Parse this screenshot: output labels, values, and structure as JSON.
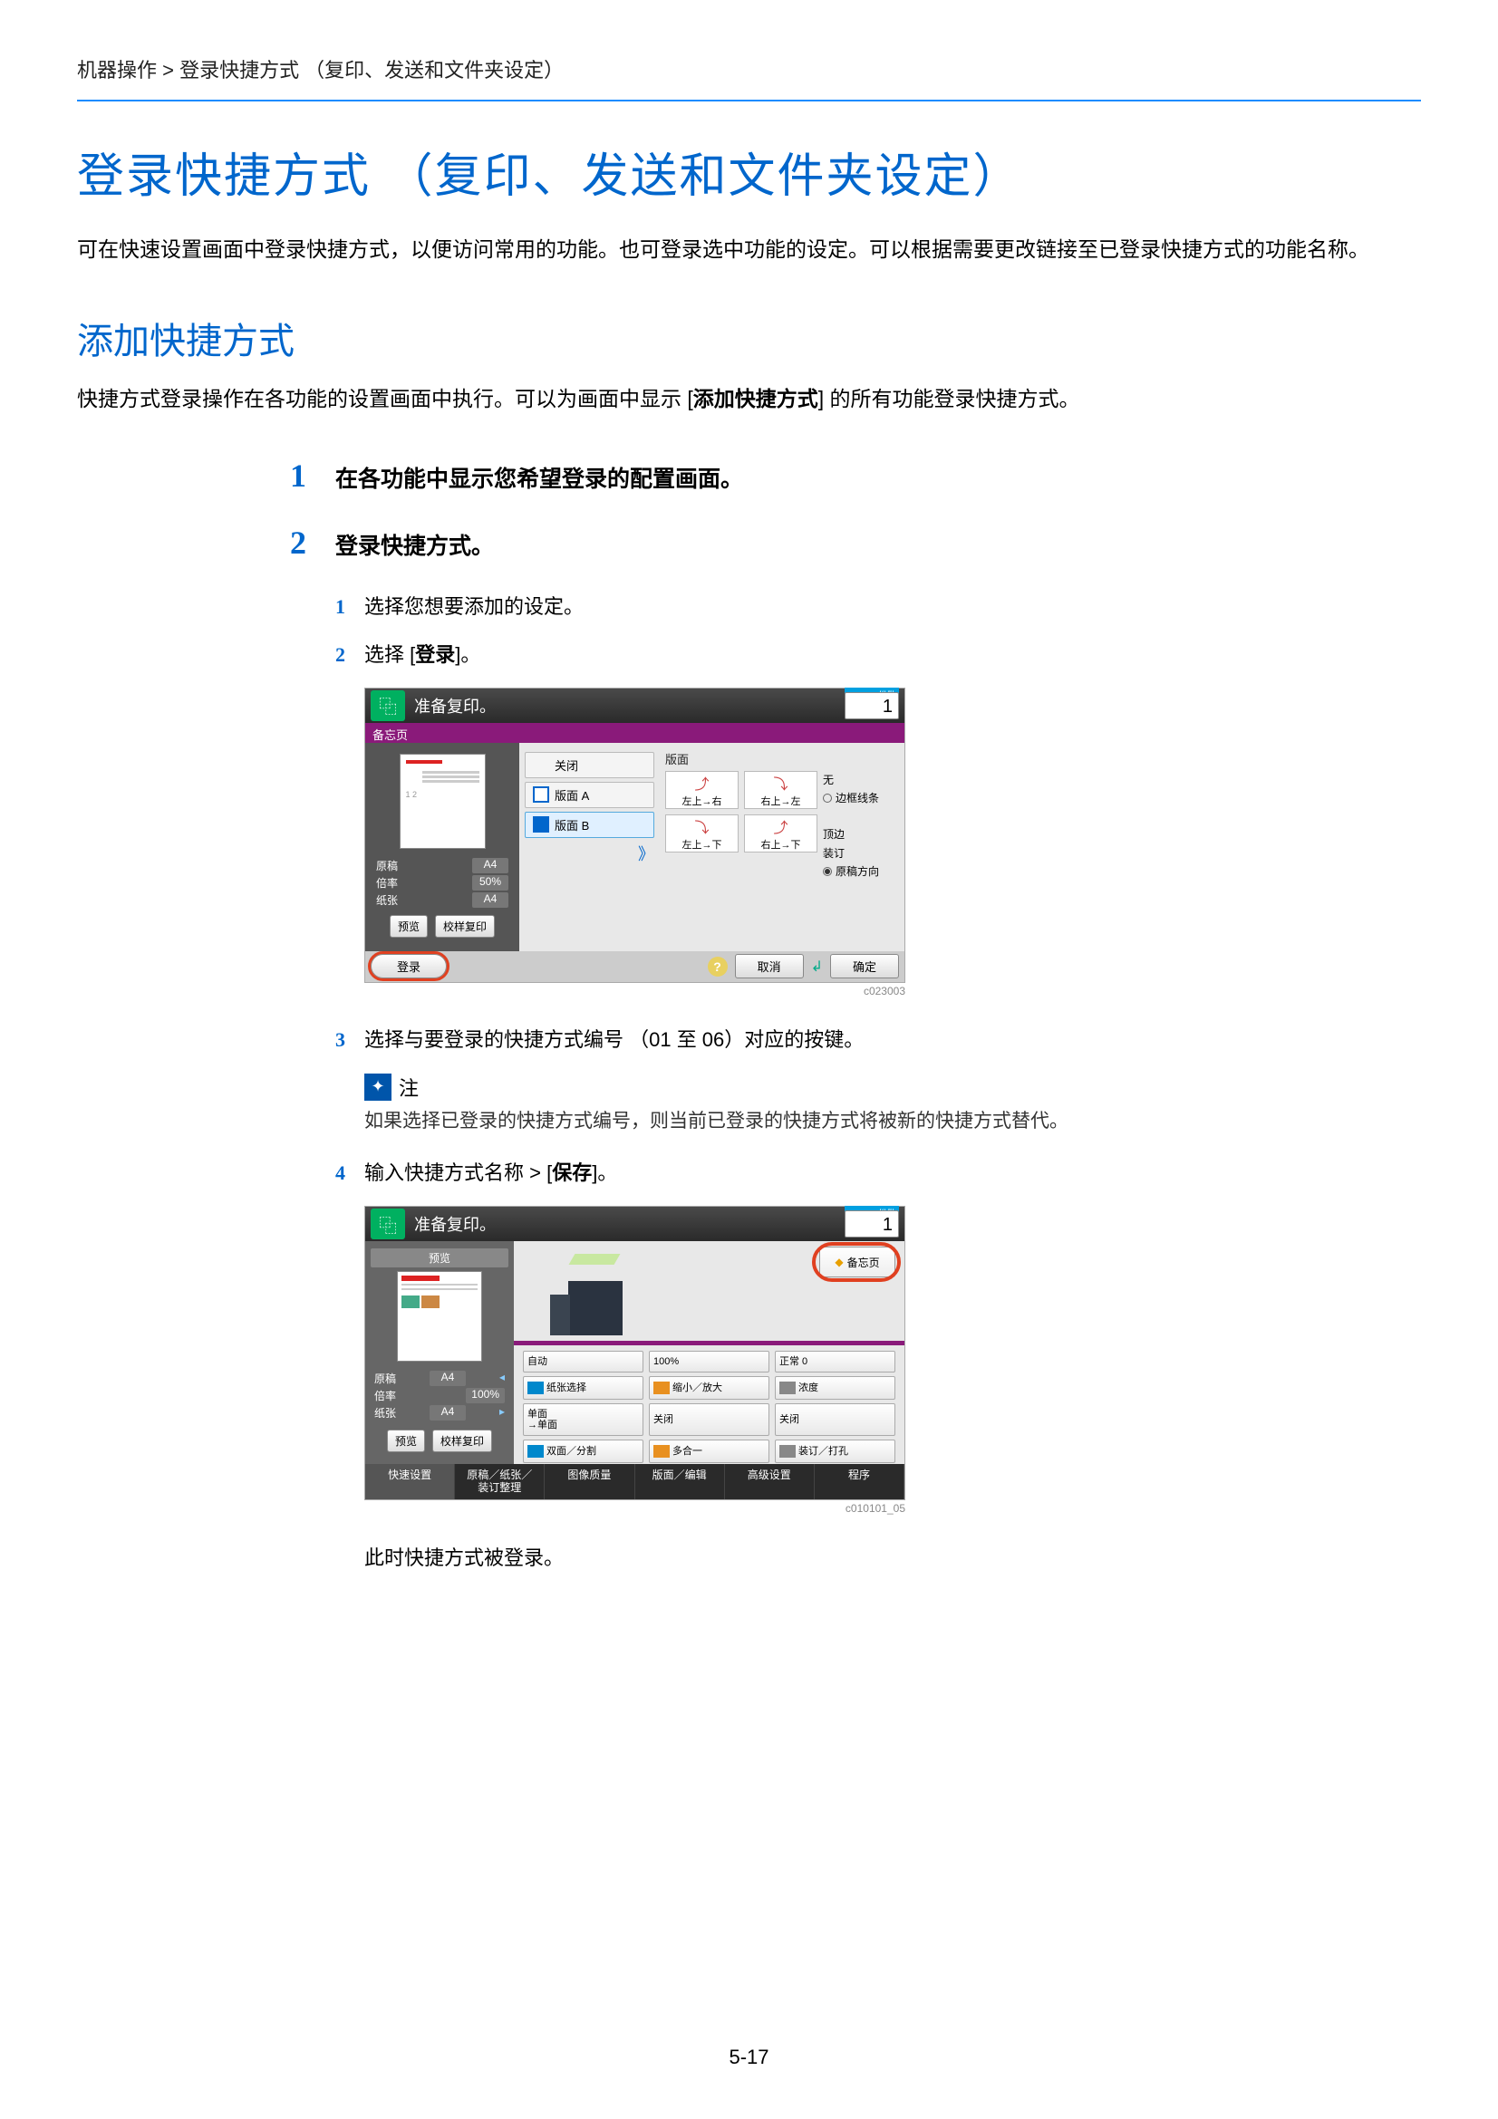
{
  "breadcrumb": "机器操作 > 登录快捷方式 （复印、发送和文件夹设定）",
  "h1": "登录快捷方式 （复印、发送和文件夹设定）",
  "intro": "可在快速设置画面中登录快捷方式，以便访问常用的功能。也可登录选中功能的设定。可以根据需要更改链接至已登录快捷方式的功能名称。",
  "h2": "添加快捷方式",
  "sub_intro_a": "快捷方式登录操作在各功能的设置画面中执行。可以为画面中显示 [",
  "sub_intro_bold": "添加快捷方式",
  "sub_intro_b": "] 的所有功能登录快捷方式。",
  "steps": {
    "s1": {
      "num": "1",
      "title": "在各功能中显示您希望登录的配置画面。"
    },
    "s2": {
      "num": "2",
      "title": "登录快捷方式。"
    }
  },
  "subs": {
    "i1": {
      "num": "1",
      "text": "选择您想要添加的设定。"
    },
    "i2": {
      "num": "2",
      "text_a": "选择 [",
      "bold": "登录",
      "text_b": "]。"
    },
    "i3": {
      "num": "3",
      "text": "选择与要登录的快捷方式编号 （01 至 06）对应的按键。"
    },
    "i4": {
      "num": "4",
      "text_a": "输入快捷方式名称 > [",
      "bold": "保存",
      "text_b": "]。"
    }
  },
  "panel1": {
    "header": "准备复印。",
    "copies_label": "份数",
    "copies": "1",
    "favbar": "备忘页",
    "left": {
      "r1a": "原稿",
      "r1b": "A4",
      "r2a": "倍率",
      "r2b": "50%",
      "r3a": "纸张",
      "r3b": "A4",
      "btn1": "预览",
      "btn2": "校样复印"
    },
    "mid": {
      "opt_off": "关闭",
      "opt_a": "版面 A",
      "opt_b": "版面 B"
    },
    "right": {
      "sec": "版面",
      "c1": "左上→右",
      "c2": "右上→左",
      "c3": "左上→下",
      "c4": "右上→下",
      "none": "无",
      "border_label": "边框线条",
      "pos_top": "顶边",
      "pos_long": "装订",
      "dir_label": "原稿方向"
    },
    "footer": {
      "register": "登录",
      "cancel": "取消",
      "ok": "确定"
    },
    "code": "c023003"
  },
  "note": {
    "title": "注",
    "body": "如果选择已登录的快捷方式编号，则当前已登录的快捷方式将被新的快捷方式替代。"
  },
  "panel2": {
    "header": "准备复印。",
    "copies_label": "份数",
    "copies": "1",
    "preview_label": "预览",
    "left": {
      "r1a": "原稿",
      "r1b": "A4",
      "r2a": "倍率",
      "r2b": "100%",
      "r3a": "纸张",
      "r3b": "A4",
      "btn1": "预览",
      "btn2": "校样复印"
    },
    "fav_btn": "备忘页",
    "grid": {
      "b11a": "自动",
      "b11b": "纸张选择",
      "b12a": "100%",
      "b12b": "缩小／放大",
      "b13a": "正常 0",
      "b13b": "浓度",
      "b21a": "单面\n→单面",
      "b21b": "双面／分割",
      "b22a": "关闭",
      "b22b": "多合一",
      "b23a": "关闭",
      "b23b": "装订／打孔"
    },
    "tabs": {
      "t1": "快速设置",
      "t2": "原稿／纸张／\n装订整理",
      "t3": "图像质量",
      "t4": "版面／编辑",
      "t5": "高级设置",
      "t6": "程序"
    },
    "code": "c010101_05"
  },
  "final": "此时快捷方式被登录。",
  "page_num": "5-17"
}
